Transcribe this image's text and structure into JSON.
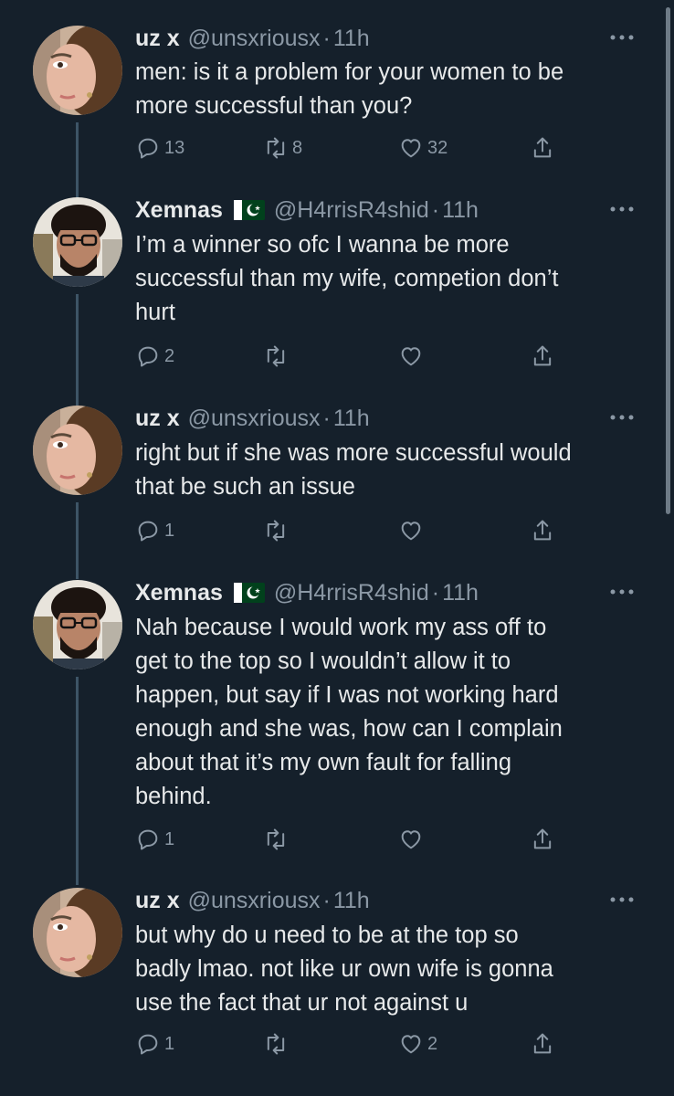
{
  "tweets": [
    {
      "name": "uz x",
      "handle": "@unsxriousx",
      "time": "11h",
      "text_lines": [
        "men: is it a problem for your women to be",
        "more successful than you?"
      ],
      "replies": "13",
      "retweets": "8",
      "likes": "32",
      "avatar": "woman-avatar",
      "flag": ""
    },
    {
      "name": "Xemnas",
      "handle": "@H4rrisR4shid",
      "time": "11h",
      "text_lines": [
        "I’m a winner so ofc I wanna be more",
        "successful than my wife, competion don’t",
        "hurt"
      ],
      "replies": "2",
      "retweets": "",
      "likes": "",
      "avatar": "man-avatar",
      "flag": "pakistan-flag"
    },
    {
      "name": "uz x",
      "handle": "@unsxriousx",
      "time": "11h",
      "text_lines": [
        "right but if she was more successful would",
        "that be such an issue"
      ],
      "replies": "1",
      "retweets": "",
      "likes": "",
      "avatar": "woman-avatar",
      "flag": ""
    },
    {
      "name": "Xemnas",
      "handle": "@H4rrisR4shid",
      "time": "11h",
      "text_lines": [
        "Nah because I would work my ass off to",
        "get to the top so I wouldn’t allow it to",
        "happen, but say if I was not working hard",
        "enough and she was, how can I complain",
        "about that it’s my own fault for falling",
        "behind."
      ],
      "replies": "1",
      "retweets": "",
      "likes": "",
      "avatar": "man-avatar",
      "flag": "pakistan-flag"
    },
    {
      "name": "uz x",
      "handle": "@unsxriousx",
      "time": "11h",
      "text_lines": [
        "but why do u need to be at the top so",
        "badly lmao. not like ur own wife is gonna",
        "use the fact that ur not against u"
      ],
      "replies": "1",
      "retweets": "",
      "likes": "2",
      "avatar": "woman-avatar",
      "flag": ""
    }
  ],
  "separator": "·",
  "colors": {
    "background": "#15202b",
    "text": "#e7e9ea",
    "secondary": "#8b98a5",
    "thread_line": "#3d5466"
  },
  "icons": [
    "reply-icon",
    "retweet-icon",
    "like-icon",
    "share-icon",
    "more-icon"
  ]
}
